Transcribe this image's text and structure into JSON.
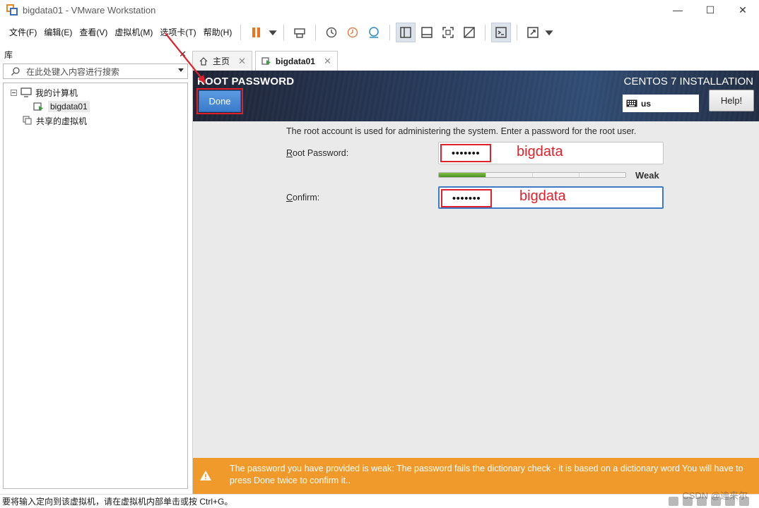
{
  "window": {
    "title": "bigdata01 - VMware Workstation",
    "controls": [
      "—",
      "☐",
      "✕"
    ]
  },
  "menu": {
    "items": [
      "文件(F)",
      "编辑(E)",
      "查看(V)",
      "虚拟机(M)",
      "选项卡(T)",
      "帮助(H)"
    ]
  },
  "library": {
    "title": "库",
    "close": "✕",
    "search_placeholder": "在此处键入内容进行搜索",
    "tree": {
      "my_computer": "我的计算机",
      "vm": "bigdata01",
      "shared": "共享的虚拟机"
    }
  },
  "tabs": [
    {
      "label": "主页",
      "close": "✕"
    },
    {
      "label": "bigdata01",
      "close": "✕"
    }
  ],
  "installer": {
    "title": "ROOT PASSWORD",
    "product": "CENTOS 7 INSTALLATION",
    "done_label": "Done",
    "keyboard_layout": "us",
    "help_label": "Help!",
    "description": "The root account is used for administering the system.  Enter a password for the root user.",
    "root_password_label_ul": "R",
    "root_password_label_rest": "oot Password:",
    "root_password_value": "•••••••",
    "confirm_label_ul": "C",
    "confirm_label_rest": "onfirm:",
    "confirm_value": "•••••••",
    "strength_label": "Weak",
    "strength_level": 0.25,
    "warning": "The password you have provided is weak: The password fails the dictionary check - it is based on a dictionary word You will have to press Done twice to confirm it.."
  },
  "annotations": {
    "password_note": "bigdata",
    "confirm_note": "bigdata"
  },
  "status": {
    "message": "要将输入定向到该虚拟机，请在虚拟机内部单击或按 Ctrl+G。",
    "watermark": "CSDN @迪来尔"
  },
  "colors": {
    "accent_red": "#e0202a",
    "done_blue": "#3a7bcb",
    "warning_orange": "#f09a2b",
    "strength_green": "#4e8f22"
  }
}
